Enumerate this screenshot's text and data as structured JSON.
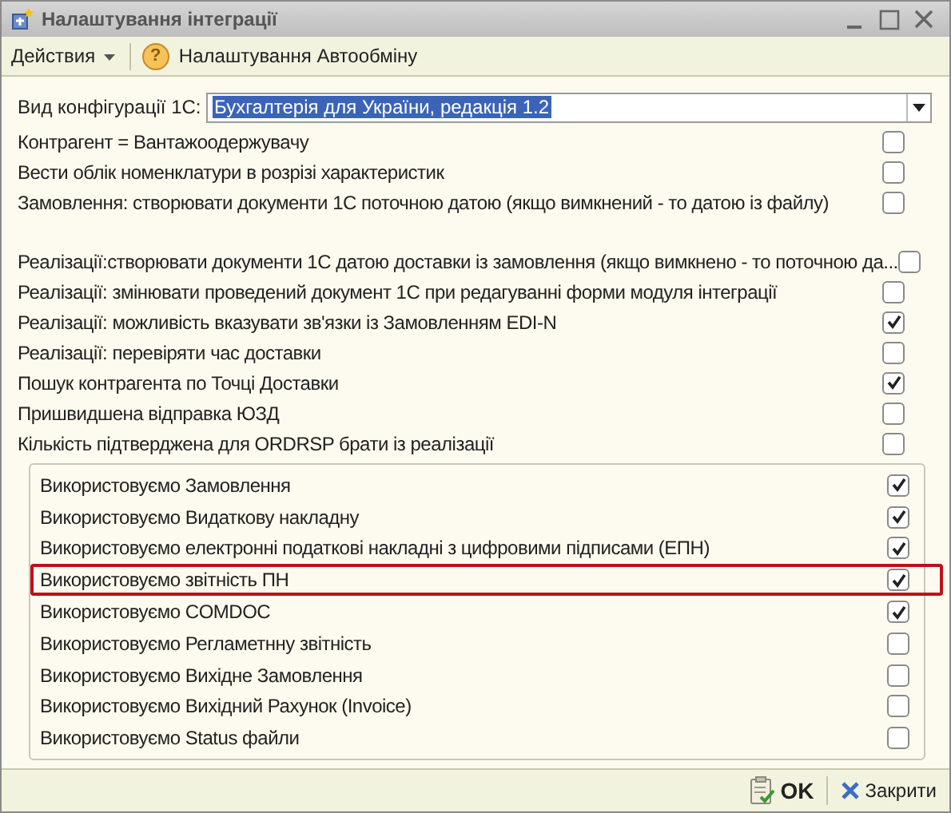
{
  "window": {
    "title": "Налаштування інтеграції"
  },
  "toolbar": {
    "actions_menu": "Действия",
    "help_icon": "?",
    "settings_button": "Налаштування Автообміну"
  },
  "config": {
    "label": "Вид конфігурації 1С:",
    "value": "Бухгалтерія для України, редакція 1.2"
  },
  "options_top": [
    {
      "label": "Контрагент = Вантажоодержувачу",
      "checked": false
    },
    {
      "label": "Вести облік номенклатури в розрізі характеристик",
      "checked": false
    },
    {
      "label": "Замовлення: створювати документи 1С поточною датою (якщо вимкнений - то датою із файлу)",
      "checked": false
    }
  ],
  "options_middle": [
    {
      "label": "Реалізації:створювати документи 1С датою доставки із замовлення (якщо вимкнено - то поточною да...",
      "checked": false
    },
    {
      "label": "Реалізації: змінювати проведений документ 1С при редагуванні форми модуля інтеграції",
      "checked": false
    },
    {
      "label": "Реалізації: можливість вказувати зв'язки із Замовленням EDI-N",
      "checked": true
    },
    {
      "label": "Реалізації: перевіряти час доставки",
      "checked": false
    },
    {
      "label": "Пошук контрагента по Точці Доставки",
      "checked": true
    },
    {
      "label": "Пришвидшена відправка ЮЗД",
      "checked": false
    },
    {
      "label": "Кількість підтверджена для ORDRSP брати із реалізації",
      "checked": false
    }
  ],
  "group_options": [
    {
      "label": "Використовуємо Замовлення",
      "checked": true,
      "highlighted": false
    },
    {
      "label": "Використовуємо Видаткову накладну",
      "checked": true,
      "highlighted": false
    },
    {
      "label": "Використовуємо електронні податкові накладні з цифровими підписами (ЕПН)",
      "checked": true,
      "highlighted": false
    },
    {
      "label": "Використовуємо звітність ПН",
      "checked": true,
      "highlighted": true
    },
    {
      "label": "Використовуємо COMDOC",
      "checked": true,
      "highlighted": false
    },
    {
      "label": "Використовуємо Регламетнну звітність",
      "checked": false,
      "highlighted": false
    },
    {
      "label": "Використовуємо Вихідне Замовлення",
      "checked": false,
      "highlighted": false
    },
    {
      "label": "Використовуємо Вихідний Рахунок (Invoice)",
      "checked": false,
      "highlighted": false
    },
    {
      "label": "Використовуємо Status файли",
      "checked": false,
      "highlighted": false
    }
  ],
  "footer": {
    "ok_button": "OK",
    "close_button": "Закрити"
  }
}
